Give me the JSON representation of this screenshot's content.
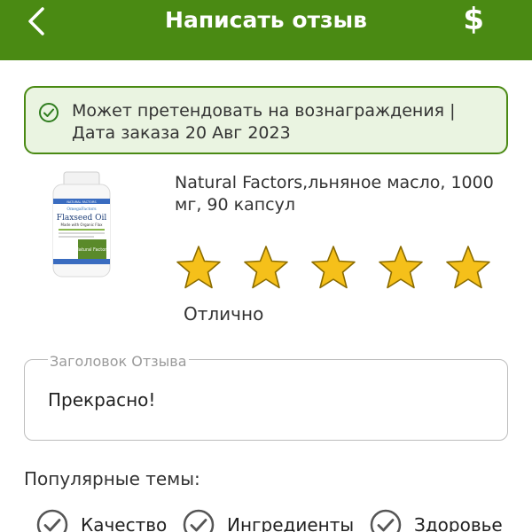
{
  "header": {
    "title": "Написать отзыв",
    "back_icon": "chevron-left-icon",
    "currency_symbol": "$",
    "background": "#4a8a13"
  },
  "notice": {
    "text": "Может претендовать на вознаграждения | Дата заказа 20 Авг 2023",
    "icon": "check-circle-icon",
    "border_color": "#4a8a13",
    "background": "#eaf4e1"
  },
  "product": {
    "name": "Natural Factors,льняное масло, 1000 мг, 90 капсул",
    "image_label": {
      "brand_line": "NATURAL FACTORS",
      "series": "OmegaFactors",
      "title": "Flaxseed Oil",
      "subtitle": "Made with Organic Flax",
      "logo": "Natural Factors"
    }
  },
  "rating": {
    "value": 5,
    "max": 5,
    "label": "Отлично",
    "star_color": "#f5c01a"
  },
  "review_title": {
    "label": "Заголовок Отзыва",
    "value": "Прекрасно!"
  },
  "topics": {
    "heading": "Популярные темы:",
    "items": [
      {
        "label": "Качество"
      },
      {
        "label": "Ингредиенты"
      },
      {
        "label": "Здоровье"
      }
    ]
  }
}
